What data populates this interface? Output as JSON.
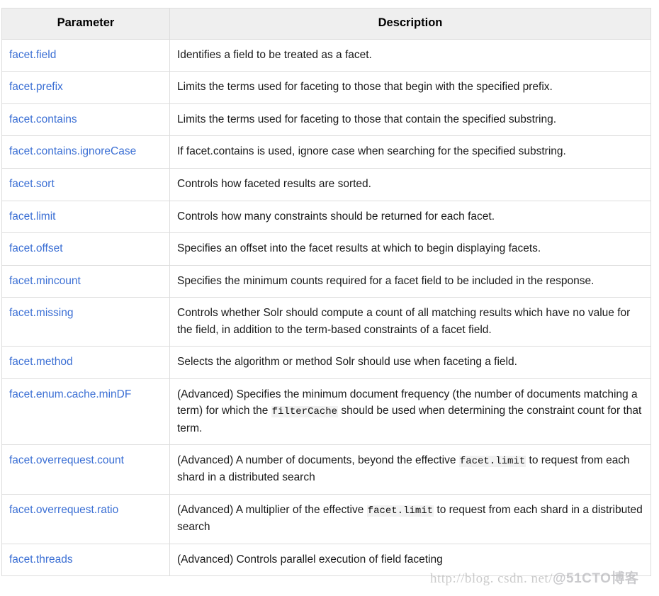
{
  "table": {
    "columns": [
      "Parameter",
      "Description"
    ],
    "rows": [
      {
        "parameter": "facet.field",
        "description": [
          {
            "type": "text",
            "value": "Identifies a field to be treated as a facet."
          }
        ]
      },
      {
        "parameter": "facet.prefix",
        "description": [
          {
            "type": "text",
            "value": "Limits the terms used for faceting to those that begin with the specified prefix."
          }
        ]
      },
      {
        "parameter": "facet.contains",
        "description": [
          {
            "type": "text",
            "value": "Limits the terms used for faceting to those that contain the specified substring."
          }
        ]
      },
      {
        "parameter": "facet.contains.ignoreCase",
        "description": [
          {
            "type": "text",
            "value": "If facet.contains is used, ignore case when searching for the specified substring."
          }
        ]
      },
      {
        "parameter": "facet.sort",
        "description": [
          {
            "type": "text",
            "value": "Controls how faceted results are sorted."
          }
        ]
      },
      {
        "parameter": "facet.limit",
        "description": [
          {
            "type": "text",
            "value": "Controls how many constraints should be returned for each facet."
          }
        ]
      },
      {
        "parameter": "facet.offset",
        "description": [
          {
            "type": "text",
            "value": "Specifies an offset into the facet results at which to begin displaying facets."
          }
        ]
      },
      {
        "parameter": "facet.mincount",
        "description": [
          {
            "type": "text",
            "value": "Specifies the minimum counts required for a facet field to be included in the response."
          }
        ]
      },
      {
        "parameter": "facet.missing",
        "description": [
          {
            "type": "text",
            "value": "Controls whether Solr should compute a count of all matching results which have no value for the field, in addition to the term-based constraints of a facet field."
          }
        ]
      },
      {
        "parameter": "facet.method",
        "description": [
          {
            "type": "text",
            "value": "Selects the algorithm or method Solr should use when faceting a field."
          }
        ]
      },
      {
        "parameter": "facet.enum.cache.minDF",
        "description": [
          {
            "type": "text",
            "value": "(Advanced) Specifies the minimum document frequency (the number of documents matching a term) for which the "
          },
          {
            "type": "code",
            "value": "filterCache"
          },
          {
            "type": "text",
            "value": " should be used when determining the constraint count for that term."
          }
        ]
      },
      {
        "parameter": "facet.overrequest.count",
        "description": [
          {
            "type": "text",
            "value": "(Advanced) A number of documents, beyond the effective "
          },
          {
            "type": "code",
            "value": "facet.limit"
          },
          {
            "type": "text",
            "value": " to request from each shard in a distributed search"
          }
        ]
      },
      {
        "parameter": "facet.overrequest.ratio",
        "description": [
          {
            "type": "text",
            "value": "(Advanced) A multiplier of the effective "
          },
          {
            "type": "code",
            "value": "facet.limit"
          },
          {
            "type": "text",
            "value": " to request from each shard in a distributed search"
          }
        ]
      },
      {
        "parameter": "facet.threads",
        "description": [
          {
            "type": "text",
            "value": "(Advanced) Controls parallel execution of field faceting"
          }
        ]
      }
    ]
  },
  "watermark": {
    "url": "http://blog. csdn. net/",
    "tag": "@51CTO博客"
  },
  "colors": {
    "link": "#3b6fd4",
    "header_bg": "#efefef",
    "border": "#dddddd",
    "code_bg": "#f2f2f2",
    "text": "#111111"
  }
}
